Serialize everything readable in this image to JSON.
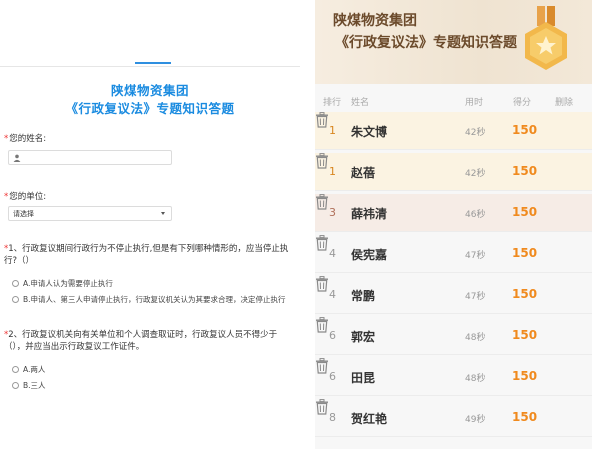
{
  "form": {
    "title_line1": "陕煤物资集团",
    "title_line2": "《行政复议法》专题知识答题",
    "name_label": "您的姓名:",
    "unit_label": "您的单位:",
    "unit_select_value": "请选择",
    "questions": [
      {
        "text": "1、行政复议期间行政行为不停止执行,但是有下列哪种情形的，应当停止执行?（）",
        "options": [
          "A.申请人认为需要停止执行",
          "B.申请人、第三人申请停止执行，行政复议机关认为其要求合理，决定停止执行"
        ]
      },
      {
        "text": "2、行政复议机关向有关单位和个人调查取证时，行政复议人员不得少于（），并应当出示行政复议工作证件。",
        "options": [
          "A.两人",
          "B.三人"
        ]
      }
    ]
  },
  "leaderboard": {
    "title_line1": "陕煤物资集团",
    "title_line2": "《行政复议法》专题知识答题",
    "headers": {
      "rank": "排行",
      "name": "姓名",
      "time": "用时",
      "score": "得分",
      "delete": "删除"
    },
    "rows": [
      {
        "rank": "1",
        "name": "朱文博",
        "time": "42秒",
        "score": "150"
      },
      {
        "rank": "1",
        "name": "赵蓓",
        "time": "42秒",
        "score": "150"
      },
      {
        "rank": "3",
        "name": "薛祎清",
        "time": "46秒",
        "score": "150"
      },
      {
        "rank": "4",
        "name": "侯宪嘉",
        "time": "47秒",
        "score": "150"
      },
      {
        "rank": "4",
        "name": "常鹏",
        "time": "47秒",
        "score": "150"
      },
      {
        "rank": "6",
        "name": "郭宏",
        "time": "48秒",
        "score": "150"
      },
      {
        "rank": "6",
        "name": "田昆",
        "time": "48秒",
        "score": "150"
      },
      {
        "rank": "8",
        "name": "贺红艳",
        "time": "49秒",
        "score": "150"
      }
    ],
    "row_backgrounds": [
      "#fbf3e2",
      "#fbf3e2",
      "#f6ece6",
      "#f7f7f7",
      "#f7f7f7",
      "#f7f7f7",
      "#f7f7f7",
      "#f7f7f7"
    ],
    "rank_colors": [
      "#d8861f",
      "#d8861f",
      "#b0705a",
      "#999999",
      "#999999",
      "#999999",
      "#999999",
      "#999999"
    ],
    "delete_icon": "trash-icon"
  },
  "colors": {
    "accent_blue": "#1a8be0",
    "score_orange": "#f08a1e",
    "required_red": "#ee3333"
  }
}
